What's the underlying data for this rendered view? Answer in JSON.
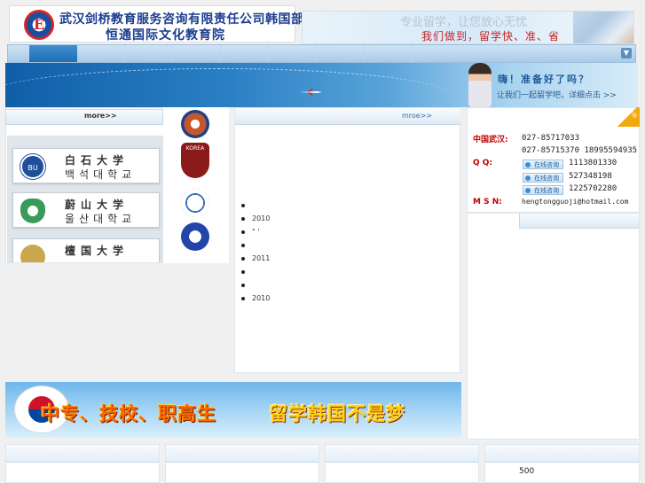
{
  "header": {
    "company_name_line1": "武汉剑桥教育服务咨询有限责任公司韩国部",
    "company_name_line2": "恒通国际文化教育院",
    "ad_slogan_top": "专业留学，让您放心无忧",
    "ad_slogan_bottom": "我们做到，留学快、准、省"
  },
  "banner": {
    "greeting": "嗨！准备好了吗？",
    "subtext": "让我们一起留学吧，详细点击 >>"
  },
  "left_panel": {
    "more_label": "more>>",
    "universities": [
      {
        "cn": "白石大学",
        "kr": "백석대학교",
        "emblem_text": "BU"
      },
      {
        "cn": "蔚山大学",
        "kr": "울산대학교",
        "emblem_text": ""
      },
      {
        "cn": "檀国大学",
        "kr": "",
        "emblem_text": ""
      }
    ],
    "column_logos": [
      "university-seal",
      "korea-university-shield",
      "kmu-seal",
      "blue-university-seal"
    ],
    "korea_shield_text": "KOREA"
  },
  "news": {
    "more_label": "mroe>>",
    "items": [
      "",
      "2010",
      "\" '",
      "",
      "2011",
      "",
      "",
      "2010"
    ]
  },
  "contact": {
    "corner_tag": "咨询",
    "region_label": "中国武汉:",
    "phone1": "027-85717033",
    "phone2": "027-85715370 18995594935",
    "qq_label": "Q    Q:",
    "qq_button_label": "在线咨询",
    "qq_numbers": [
      "1113801330",
      "527348198",
      "1225702280"
    ],
    "msn_label": "M S N:",
    "msn_value": "hengtongguoji@hotmail.com"
  },
  "promo": {
    "text_left": "中专、技校、职高生",
    "text_right": "留学韩国不是梦"
  },
  "footer": {
    "count": "500"
  },
  "colors": {
    "brand_blue": "#1a3d8f",
    "accent_red": "#c00000",
    "banner_blue": "#2a7fc4"
  }
}
